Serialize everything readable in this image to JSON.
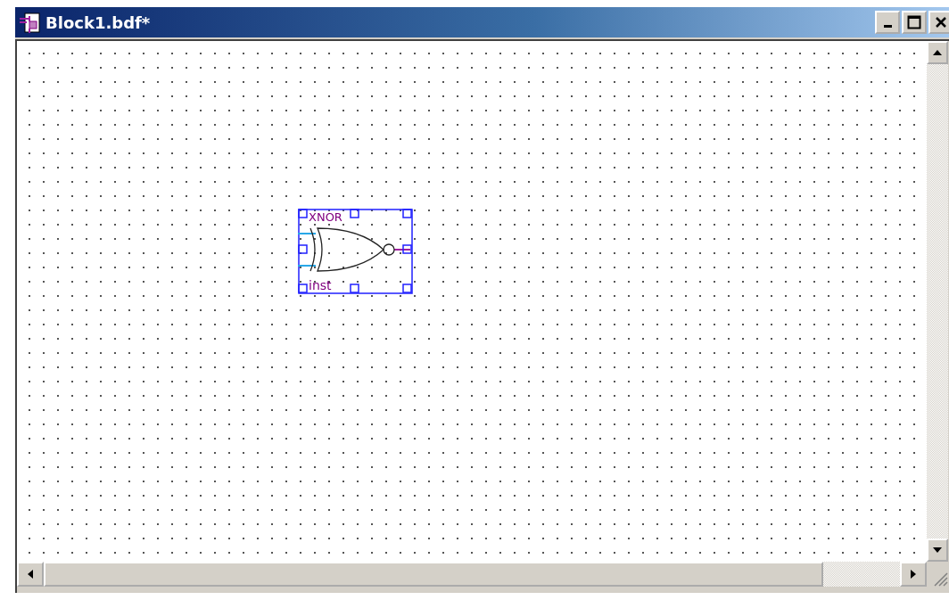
{
  "window": {
    "title": "Block1.bdf*"
  },
  "symbol": {
    "kind": "xnor",
    "name": "XNOR",
    "instance": "inst",
    "selected": true
  }
}
